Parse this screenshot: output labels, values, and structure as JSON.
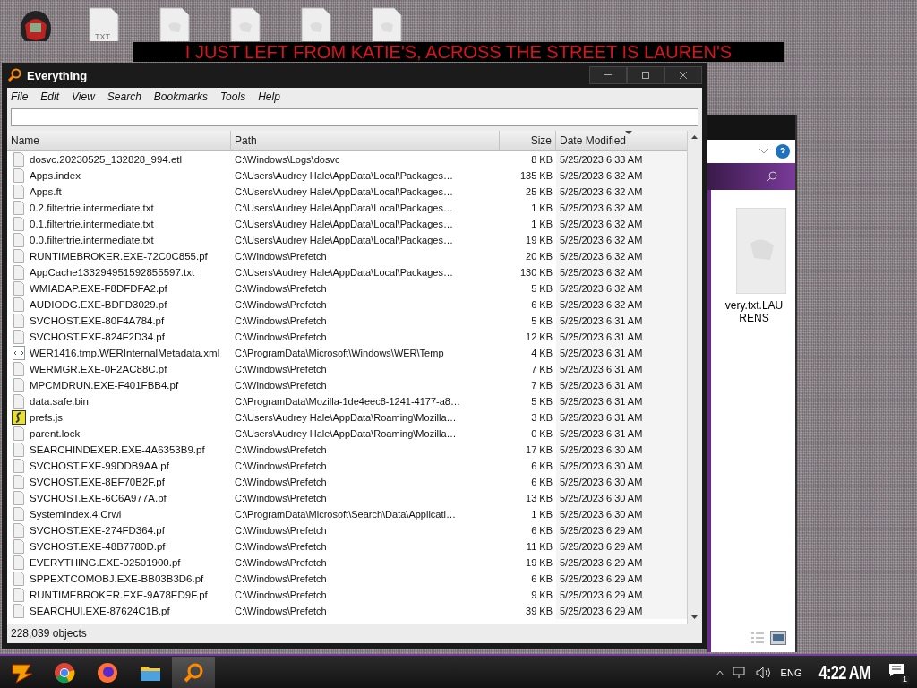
{
  "banner": {
    "text": "I JUST LEFT FROM KATIE'S, ACROSS THE STREET IS LAUREN'S"
  },
  "desktop_icons": [
    {
      "kind": "app"
    },
    {
      "kind": "txt",
      "label": "TXT"
    },
    {
      "kind": "file"
    },
    {
      "kind": "file"
    },
    {
      "kind": "file"
    },
    {
      "kind": "file"
    }
  ],
  "window": {
    "title": "Everything",
    "menu": [
      "File",
      "Edit",
      "View",
      "Search",
      "Bookmarks",
      "Tools",
      "Help"
    ],
    "columns": [
      {
        "label": "Name",
        "sorted": false
      },
      {
        "label": "Path",
        "sorted": false
      },
      {
        "label": "Size",
        "sorted": false
      },
      {
        "label": "Date Modified",
        "sorted": true
      }
    ],
    "rows": [
      {
        "kind": "file",
        "name": "dosvc.20230525_132828_994.etl",
        "path": "C:\\Windows\\Logs\\dosvc",
        "size": "8 KB",
        "date": "5/25/2023 6:33 AM"
      },
      {
        "kind": "file",
        "name": "Apps.index",
        "path": "C:\\Users\\Audrey Hale\\AppData\\Local\\Packages…",
        "size": "135 KB",
        "date": "5/25/2023 6:32 AM"
      },
      {
        "kind": "file",
        "name": "Apps.ft",
        "path": "C:\\Users\\Audrey Hale\\AppData\\Local\\Packages…",
        "size": "25 KB",
        "date": "5/25/2023 6:32 AM"
      },
      {
        "kind": "file",
        "name": "0.2.filtertrie.intermediate.txt",
        "path": "C:\\Users\\Audrey Hale\\AppData\\Local\\Packages…",
        "size": "1 KB",
        "date": "5/25/2023 6:32 AM"
      },
      {
        "kind": "file",
        "name": "0.1.filtertrie.intermediate.txt",
        "path": "C:\\Users\\Audrey Hale\\AppData\\Local\\Packages…",
        "size": "1 KB",
        "date": "5/25/2023 6:32 AM"
      },
      {
        "kind": "file",
        "name": "0.0.filtertrie.intermediate.txt",
        "path": "C:\\Users\\Audrey Hale\\AppData\\Local\\Packages…",
        "size": "19 KB",
        "date": "5/25/2023 6:32 AM"
      },
      {
        "kind": "file",
        "name": "RUNTIMEBROKER.EXE-72C0C855.pf",
        "path": "C:\\Windows\\Prefetch",
        "size": "20 KB",
        "date": "5/25/2023 6:32 AM"
      },
      {
        "kind": "file",
        "name": "AppCache133294951592855597.txt",
        "path": "C:\\Users\\Audrey Hale\\AppData\\Local\\Packages…",
        "size": "130 KB",
        "date": "5/25/2023 6:32 AM"
      },
      {
        "kind": "file",
        "name": "WMIADAP.EXE-F8DFDFA2.pf",
        "path": "C:\\Windows\\Prefetch",
        "size": "5 KB",
        "date": "5/25/2023 6:32 AM"
      },
      {
        "kind": "file",
        "name": "AUDIODG.EXE-BDFD3029.pf",
        "path": "C:\\Windows\\Prefetch",
        "size": "6 KB",
        "date": "5/25/2023 6:32 AM"
      },
      {
        "kind": "file",
        "name": "SVCHOST.EXE-80F4A784.pf",
        "path": "C:\\Windows\\Prefetch",
        "size": "5 KB",
        "date": "5/25/2023 6:31 AM"
      },
      {
        "kind": "file",
        "name": "SVCHOST.EXE-824F2D34.pf",
        "path": "C:\\Windows\\Prefetch",
        "size": "12 KB",
        "date": "5/25/2023 6:31 AM"
      },
      {
        "kind": "xml",
        "name": "WER1416.tmp.WERInternalMetadata.xml",
        "path": "C:\\ProgramData\\Microsoft\\Windows\\WER\\Temp",
        "size": "4 KB",
        "date": "5/25/2023 6:31 AM"
      },
      {
        "kind": "file",
        "name": "WERMGR.EXE-0F2AC88C.pf",
        "path": "C:\\Windows\\Prefetch",
        "size": "7 KB",
        "date": "5/25/2023 6:31 AM"
      },
      {
        "kind": "file",
        "name": "MPCMDRUN.EXE-F401FBB4.pf",
        "path": "C:\\Windows\\Prefetch",
        "size": "7 KB",
        "date": "5/25/2023 6:31 AM"
      },
      {
        "kind": "file",
        "name": "data.safe.bin",
        "path": "C:\\ProgramData\\Mozilla-1de4eec8-1241-4177-a8…",
        "size": "5 KB",
        "date": "5/25/2023 6:31 AM"
      },
      {
        "kind": "script",
        "name": "prefs.js",
        "path": "C:\\Users\\Audrey Hale\\AppData\\Roaming\\Mozilla…",
        "size": "3 KB",
        "date": "5/25/2023 6:31 AM"
      },
      {
        "kind": "file",
        "name": "parent.lock",
        "path": "C:\\Users\\Audrey Hale\\AppData\\Roaming\\Mozilla…",
        "size": "0 KB",
        "date": "5/25/2023 6:31 AM"
      },
      {
        "kind": "file",
        "name": "SEARCHINDEXER.EXE-4A6353B9.pf",
        "path": "C:\\Windows\\Prefetch",
        "size": "17 KB",
        "date": "5/25/2023 6:30 AM"
      },
      {
        "kind": "file",
        "name": "SVCHOST.EXE-99DDB9AA.pf",
        "path": "C:\\Windows\\Prefetch",
        "size": "6 KB",
        "date": "5/25/2023 6:30 AM"
      },
      {
        "kind": "file",
        "name": "SVCHOST.EXE-8EF70B2F.pf",
        "path": "C:\\Windows\\Prefetch",
        "size": "6 KB",
        "date": "5/25/2023 6:30 AM"
      },
      {
        "kind": "file",
        "name": "SVCHOST.EXE-6C6A977A.pf",
        "path": "C:\\Windows\\Prefetch",
        "size": "13 KB",
        "date": "5/25/2023 6:30 AM"
      },
      {
        "kind": "file",
        "name": "SystemIndex.4.Crwl",
        "path": "C:\\ProgramData\\Microsoft\\Search\\Data\\Applicati…",
        "size": "1 KB",
        "date": "5/25/2023 6:30 AM"
      },
      {
        "kind": "file",
        "name": "SVCHOST.EXE-274FD364.pf",
        "path": "C:\\Windows\\Prefetch",
        "size": "6 KB",
        "date": "5/25/2023 6:29 AM"
      },
      {
        "kind": "file",
        "name": "SVCHOST.EXE-48B7780D.pf",
        "path": "C:\\Windows\\Prefetch",
        "size": "11 KB",
        "date": "5/25/2023 6:29 AM"
      },
      {
        "kind": "file",
        "name": "EVERYTHING.EXE-02501900.pf",
        "path": "C:\\Windows\\Prefetch",
        "size": "19 KB",
        "date": "5/25/2023 6:29 AM"
      },
      {
        "kind": "file",
        "name": "SPPEXTCOMOBJ.EXE-BB03B3D6.pf",
        "path": "C:\\Windows\\Prefetch",
        "size": "6 KB",
        "date": "5/25/2023 6:29 AM"
      },
      {
        "kind": "file",
        "name": "RUNTIMEBROKER.EXE-9A78ED9F.pf",
        "path": "C:\\Windows\\Prefetch",
        "size": "9 KB",
        "date": "5/25/2023 6:29 AM"
      },
      {
        "kind": "file",
        "name": "SEARCHUI.EXE-87624C1B.pf",
        "path": "C:\\Windows\\Prefetch",
        "size": "39 KB",
        "date": "5/25/2023 6:29 AM"
      }
    ],
    "status": "228,039 objects"
  },
  "back_window": {
    "file_label": "very.txt.LAURENS"
  },
  "taskbar": {
    "apps": [
      {
        "kind": "start",
        "selected": false
      },
      {
        "kind": "chrome",
        "selected": false
      },
      {
        "kind": "firefox",
        "selected": false
      },
      {
        "kind": "folder",
        "selected": false
      },
      {
        "kind": "search",
        "selected": true
      }
    ],
    "language": "ENG",
    "time": "4:22 AM",
    "notifications": "1"
  }
}
